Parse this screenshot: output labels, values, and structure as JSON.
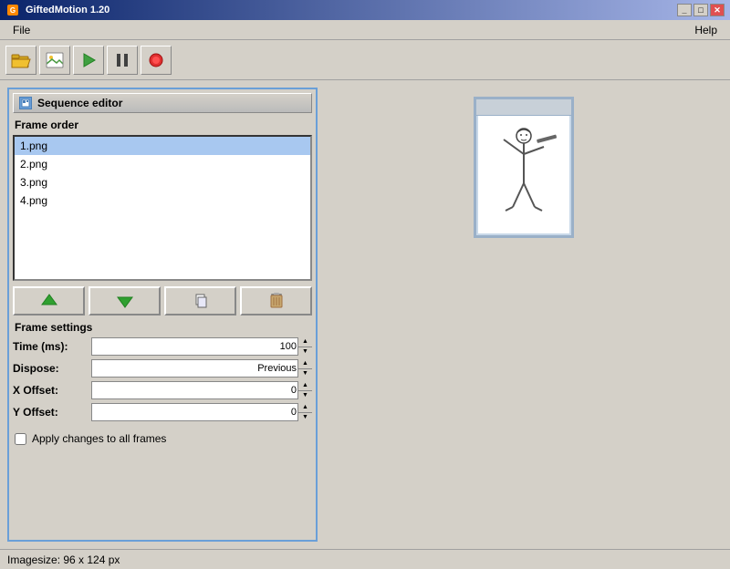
{
  "titleBar": {
    "title": "GiftedMotion 1.20",
    "minimizeLabel": "_",
    "maximizeLabel": "□",
    "closeLabel": "✕"
  },
  "menuBar": {
    "fileLabel": "File",
    "helpLabel": "Help"
  },
  "toolbar": {
    "openIcon": "open-folder-icon",
    "imageIcon": "image-icon",
    "playIcon": "play-icon",
    "pauseIcon": "pause-icon",
    "recordIcon": "record-icon"
  },
  "sequenceEditor": {
    "panelTitle": "Sequence editor",
    "frameOrderLabel": "Frame order",
    "frames": [
      {
        "name": "1.png",
        "selected": true
      },
      {
        "name": "2.png",
        "selected": false
      },
      {
        "name": "3.png",
        "selected": false
      },
      {
        "name": "4.png",
        "selected": false
      }
    ],
    "moveUpArrow": "▲",
    "moveDownArrow": "▼",
    "copyIcon": "📋",
    "deleteIcon": "🗑",
    "frameSettings": {
      "sectionLabel": "Frame settings",
      "timeLabel": "Time (ms):",
      "timeValue": "100",
      "disposeLabel": "Dispose:",
      "disposeValue": "Previous",
      "xOffsetLabel": "X Offset:",
      "xOffsetValue": "0",
      "yOffsetLabel": "Y Offset:",
      "yOffsetValue": "0",
      "checkboxLabel": "Apply changes to all frames",
      "checkboxChecked": false
    }
  },
  "statusBar": {
    "text": "Imagesize: 96 x 124 px"
  }
}
